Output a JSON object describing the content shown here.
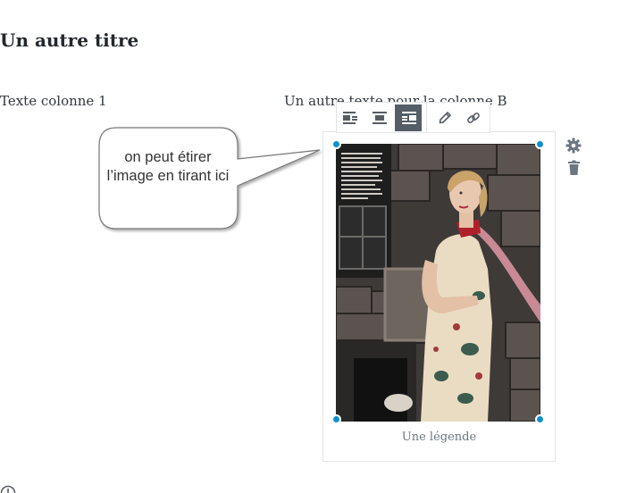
{
  "page": {
    "title": "Un autre titre",
    "column1_text": "Texte colonne 1",
    "column2_text": "Un autre texte pour la colonne B"
  },
  "image_block": {
    "caption": "Une légende",
    "toolbar": [
      {
        "name": "align-left",
        "icon": "align-left-icon",
        "active": false
      },
      {
        "name": "align-center",
        "icon": "align-center-icon",
        "active": false
      },
      {
        "name": "align-right",
        "icon": "align-right-icon",
        "active": true
      },
      {
        "name": "edit",
        "icon": "pencil-icon",
        "active": false
      },
      {
        "name": "link",
        "icon": "link-icon",
        "active": false
      }
    ],
    "side_actions": [
      "gear-icon",
      "trash-icon"
    ]
  },
  "annotation": {
    "text": "on peut étirer l’image en tirant ici"
  },
  "colors": {
    "handle": "#0e91c9",
    "toolbar_active": "#555d66",
    "border": "#e2e4e7"
  }
}
